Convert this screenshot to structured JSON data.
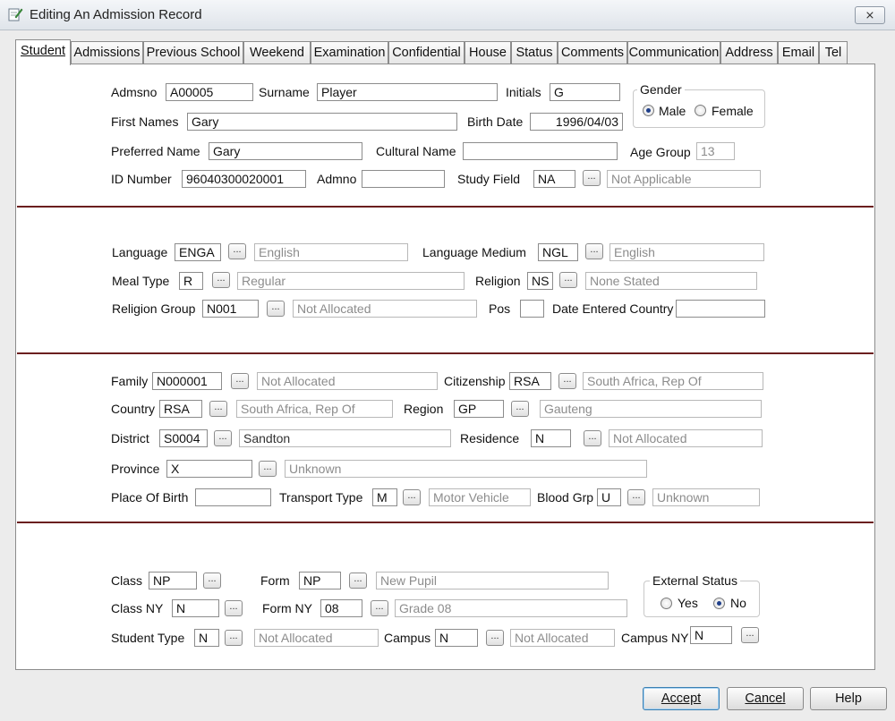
{
  "window": {
    "title": "Editing An Admission Record",
    "close_label": "⨯"
  },
  "tabs": [
    "Student",
    "Admissions",
    "Previous School",
    "Weekend",
    "Examination",
    "Confidential",
    "House",
    "Status",
    "Comments",
    "Communication",
    "Address",
    "Email",
    "Tel"
  ],
  "section1": {
    "admsno_label": "Admsno",
    "admsno": "A00005",
    "surname_label": "Surname",
    "surname": "Player",
    "initials_label": "Initials",
    "initials": "G",
    "gender_title": "Gender",
    "male_label": "Male",
    "female_label": "Female",
    "gender_selected": "Male",
    "first_names_label": "First Names",
    "first_names": "Gary",
    "birth_date_label": "Birth Date",
    "birth_date": "1996/04/03",
    "preferred_name_label": "Preferred Name",
    "preferred_name": "Gary",
    "cultural_name_label": "Cultural Name",
    "cultural_name": "",
    "age_group_label": "Age Group",
    "age_group": "13",
    "id_number_label": "ID Number",
    "id_number": "96040300020001",
    "admno_label": "Admno",
    "admno": "",
    "study_field_label": "Study Field",
    "study_field_code": "NA",
    "study_field_desc": "Not Applicable"
  },
  "section2": {
    "language_label": "Language",
    "language_code": "ENGA",
    "language_desc": "English",
    "language_medium_label": "Language Medium",
    "language_medium_code": "NGL",
    "language_medium_desc": "English",
    "meal_type_label": "Meal Type",
    "meal_type_code": "R",
    "meal_type_desc": "Regular",
    "religion_label": "Religion",
    "religion_code": "NS",
    "religion_desc": "None Stated",
    "religion_group_label": "Religion Group",
    "religion_group_code": "N001",
    "religion_group_desc": "Not Allocated",
    "pos_label": "Pos",
    "pos": "",
    "date_entered_label": "Date Entered Country",
    "date_entered": ""
  },
  "section3": {
    "family_label": "Family",
    "family_code": "N000001",
    "family_desc": "Not Allocated",
    "citizenship_label": "Citizenship",
    "citizenship_code": "RSA",
    "citizenship_desc": "South Africa, Rep Of",
    "country_label": "Country",
    "country_code": "RSA",
    "country_desc": "South Africa, Rep Of",
    "region_label": "Region",
    "region_code": "GP",
    "region_desc": "Gauteng",
    "district_label": "District",
    "district_code": "S0004",
    "district_desc": "Sandton",
    "residence_label": "Residence",
    "residence_code": "N",
    "residence_desc": "Not Allocated",
    "province_label": "Province",
    "province_code": "X",
    "province_desc": "Unknown",
    "place_of_birth_label": "Place Of Birth",
    "place_of_birth": "",
    "transport_label": "Transport Type",
    "transport_code": "M",
    "transport_desc": "Motor Vehicle",
    "blood_label": "Blood Grp",
    "blood_code": "U",
    "blood_desc": "Unknown"
  },
  "section4": {
    "class_label": "Class",
    "class_code": "NP",
    "form_label": "Form",
    "form_code": "NP",
    "form_desc": "New Pupil",
    "external_title": "External Status",
    "yes_label": "Yes",
    "no_label": "No",
    "external_selected": "No",
    "class_ny_label": "Class NY",
    "class_ny_code": "N",
    "form_ny_label": "Form NY",
    "form_ny_code": "08",
    "form_ny_desc": "Grade 08",
    "student_type_label": "Student Type",
    "student_type_code": "N",
    "student_type_desc": "Not Allocated",
    "campus_label": "Campus",
    "campus_code": "N",
    "campus_desc": "Not Allocated",
    "campus_ny_label": "Campus NY",
    "campus_ny_code": "N"
  },
  "buttons": {
    "ellipsis": "...",
    "accept": "Accept",
    "cancel": "Cancel",
    "help": "Help"
  }
}
